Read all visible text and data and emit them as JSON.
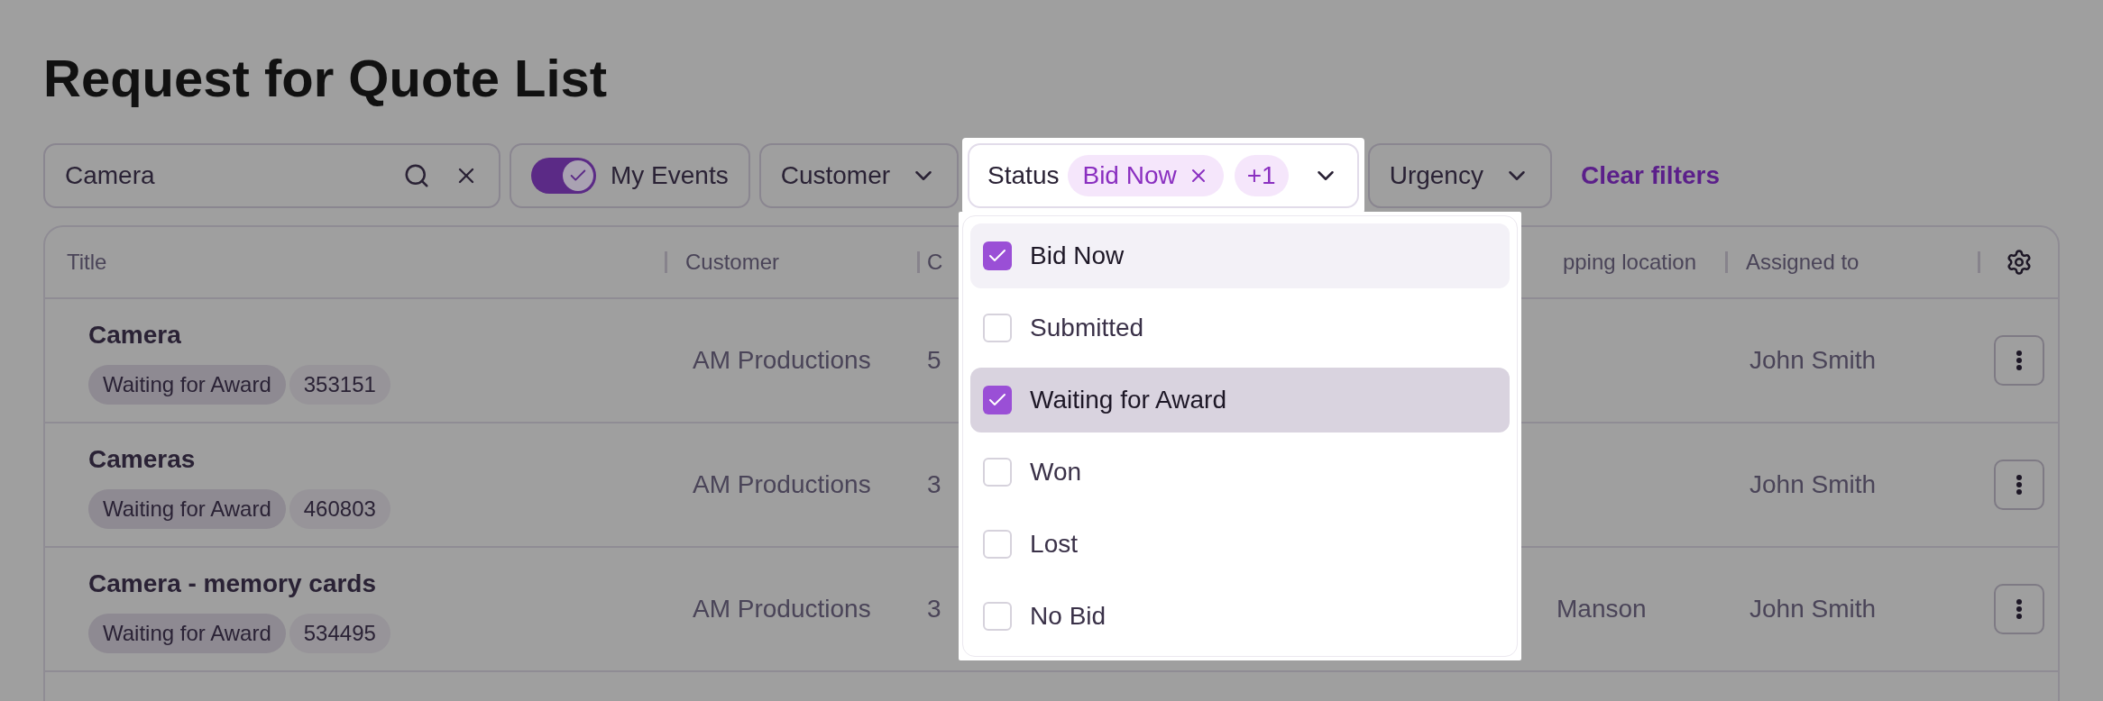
{
  "page_title": "Request for Quote List",
  "toolbar": {
    "search": {
      "value": "Camera"
    },
    "my_events": {
      "label": "My Events",
      "on": true
    },
    "customer_filter": {
      "label": "Customer"
    },
    "status_filter": {
      "label": "Status",
      "chips": [
        "Bid Now"
      ],
      "more": "+1",
      "expanded": true,
      "options": [
        {
          "label": "Bid Now",
          "checked": true,
          "focused": true,
          "hovered": false
        },
        {
          "label": "Submitted",
          "checked": false,
          "focused": false,
          "hovered": false
        },
        {
          "label": "Waiting for Award",
          "checked": true,
          "focused": false,
          "hovered": true
        },
        {
          "label": "Won",
          "checked": false,
          "focused": false,
          "hovered": false
        },
        {
          "label": "Lost",
          "checked": false,
          "focused": false,
          "hovered": false
        },
        {
          "label": "No Bid",
          "checked": false,
          "focused": false,
          "hovered": false
        }
      ]
    },
    "urgency_filter": {
      "label": "Urgency"
    },
    "clear": "Clear filters"
  },
  "table": {
    "columns": [
      "Title",
      "Customer",
      "C",
      "pping location",
      "Assigned to"
    ],
    "rows": [
      {
        "title": "Camera",
        "status": "Waiting for Award",
        "number": "353151",
        "customer": "AM Productions",
        "column_3": "5",
        "column_4": "",
        "assigned": "John Smith"
      },
      {
        "title": "Cameras",
        "status": "Waiting for Award",
        "number": "460803",
        "customer": "AM Productions",
        "column_3": "3",
        "column_4": "",
        "assigned": "John Smith"
      },
      {
        "title": "Camera - memory cards",
        "status": "Waiting for Award",
        "number": "534495",
        "customer": "AM Productions",
        "column_3": "3",
        "column_4": "Manson",
        "assigned": "John Smith"
      }
    ]
  }
}
